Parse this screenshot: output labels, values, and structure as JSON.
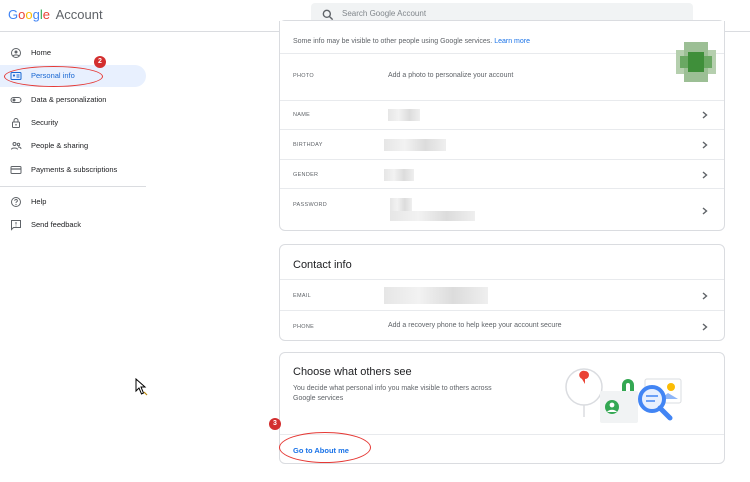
{
  "header": {
    "logo_google": "Google",
    "logo_account": "Account",
    "search_placeholder": "Search Google Account"
  },
  "sidebar": {
    "items": [
      {
        "label": "Home",
        "icon": "home-icon"
      },
      {
        "label": "Personal info",
        "icon": "id-card-icon"
      },
      {
        "label": "Data & personalization",
        "icon": "toggle-icon"
      },
      {
        "label": "Security",
        "icon": "lock-icon"
      },
      {
        "label": "People & sharing",
        "icon": "people-icon"
      },
      {
        "label": "Payments & subscriptions",
        "icon": "credit-card-icon"
      },
      {
        "label": "Help",
        "icon": "help-icon"
      },
      {
        "label": "Send feedback",
        "icon": "feedback-icon"
      }
    ]
  },
  "annotations": {
    "step_2": "2",
    "step_3": "3"
  },
  "profile_card": {
    "description": "Some info may be visible to other people using Google services.",
    "learn_more": "Learn more",
    "rows": [
      {
        "label": "PHOTO",
        "value": "Add a photo to personalize your account"
      },
      {
        "label": "NAME",
        "value": ""
      },
      {
        "label": "BIRTHDAY",
        "value": ""
      },
      {
        "label": "GENDER",
        "value": ""
      },
      {
        "label": "PASSWORD",
        "value": ""
      }
    ]
  },
  "contact_card": {
    "title": "Contact info",
    "rows": [
      {
        "label": "EMAIL",
        "value": ""
      },
      {
        "label": "PHONE",
        "value": "Add a recovery phone to help keep your account secure"
      }
    ]
  },
  "choose_card": {
    "title": "Choose what others see",
    "description_line1": "You decide what personal info you make visible to others across",
    "description_line2": "Google services",
    "link": "Go to About me"
  },
  "colors": {
    "accent": "#1a73e8",
    "active_bg": "#e8f0fe",
    "annotation_red": "#d32f2f"
  }
}
